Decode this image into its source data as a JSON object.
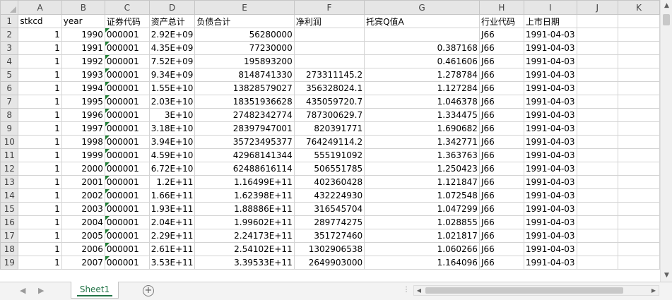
{
  "columns": [
    "A",
    "B",
    "C",
    "D",
    "E",
    "F",
    "G",
    "H",
    "I",
    "J",
    "K"
  ],
  "header_row": {
    "number": "1",
    "cells": [
      "stkcd",
      "year",
      "证券代码",
      "资产总计",
      "负债合计",
      "净利润",
      "托宾Q值A",
      "行业代码",
      "上市日期",
      "",
      ""
    ]
  },
  "rows": [
    {
      "number": "2",
      "stkcd": "1",
      "year": "1990",
      "code": "000001",
      "assets": "2.92E+09",
      "liabilities": "56280000",
      "net_profit": "",
      "tobin_q": "",
      "industry": "J66",
      "listed": "1991-04-03"
    },
    {
      "number": "3",
      "stkcd": "1",
      "year": "1991",
      "code": "000001",
      "assets": "4.35E+09",
      "liabilities": "77230000",
      "net_profit": "",
      "tobin_q": "0.387168",
      "industry": "J66",
      "listed": "1991-04-03"
    },
    {
      "number": "4",
      "stkcd": "1",
      "year": "1992",
      "code": "000001",
      "assets": "7.52E+09",
      "liabilities": "195893200",
      "net_profit": "",
      "tobin_q": "0.461606",
      "industry": "J66",
      "listed": "1991-04-03"
    },
    {
      "number": "5",
      "stkcd": "1",
      "year": "1993",
      "code": "000001",
      "assets": "9.34E+09",
      "liabilities": "8148741330",
      "net_profit": "273311145.2",
      "tobin_q": "1.278784",
      "industry": "J66",
      "listed": "1991-04-03"
    },
    {
      "number": "6",
      "stkcd": "1",
      "year": "1994",
      "code": "000001",
      "assets": "1.55E+10",
      "liabilities": "13828579027",
      "net_profit": "356328024.1",
      "tobin_q": "1.127284",
      "industry": "J66",
      "listed": "1991-04-03"
    },
    {
      "number": "7",
      "stkcd": "1",
      "year": "1995",
      "code": "000001",
      "assets": "2.03E+10",
      "liabilities": "18351936628",
      "net_profit": "435059720.7",
      "tobin_q": "1.046378",
      "industry": "J66",
      "listed": "1991-04-03"
    },
    {
      "number": "8",
      "stkcd": "1",
      "year": "1996",
      "code": "000001",
      "assets": "3E+10",
      "liabilities": "27482342774",
      "net_profit": "787300629.7",
      "tobin_q": "1.334475",
      "industry": "J66",
      "listed": "1991-04-03"
    },
    {
      "number": "9",
      "stkcd": "1",
      "year": "1997",
      "code": "000001",
      "assets": "3.18E+10",
      "liabilities": "28397947001",
      "net_profit": "820391771",
      "tobin_q": "1.690682",
      "industry": "J66",
      "listed": "1991-04-03"
    },
    {
      "number": "10",
      "stkcd": "1",
      "year": "1998",
      "code": "000001",
      "assets": "3.94E+10",
      "liabilities": "35723495377",
      "net_profit": "764249114.2",
      "tobin_q": "1.342771",
      "industry": "J66",
      "listed": "1991-04-03"
    },
    {
      "number": "11",
      "stkcd": "1",
      "year": "1999",
      "code": "000001",
      "assets": "4.59E+10",
      "liabilities": "42968141344",
      "net_profit": "555191092",
      "tobin_q": "1.363763",
      "industry": "J66",
      "listed": "1991-04-03"
    },
    {
      "number": "12",
      "stkcd": "1",
      "year": "2000",
      "code": "000001",
      "assets": "6.72E+10",
      "liabilities": "62488616114",
      "net_profit": "506551785",
      "tobin_q": "1.250423",
      "industry": "J66",
      "listed": "1991-04-03"
    },
    {
      "number": "13",
      "stkcd": "1",
      "year": "2001",
      "code": "000001",
      "assets": "1.2E+11",
      "liabilities": "1.16499E+11",
      "net_profit": "402360428",
      "tobin_q": "1.121847",
      "industry": "J66",
      "listed": "1991-04-03"
    },
    {
      "number": "14",
      "stkcd": "1",
      "year": "2002",
      "code": "000001",
      "assets": "1.66E+11",
      "liabilities": "1.62398E+11",
      "net_profit": "432224930",
      "tobin_q": "1.072548",
      "industry": "J66",
      "listed": "1991-04-03"
    },
    {
      "number": "15",
      "stkcd": "1",
      "year": "2003",
      "code": "000001",
      "assets": "1.93E+11",
      "liabilities": "1.88886E+11",
      "net_profit": "316545704",
      "tobin_q": "1.047299",
      "industry": "J66",
      "listed": "1991-04-03"
    },
    {
      "number": "16",
      "stkcd": "1",
      "year": "2004",
      "code": "000001",
      "assets": "2.04E+11",
      "liabilities": "1.99602E+11",
      "net_profit": "289774275",
      "tobin_q": "1.028855",
      "industry": "J66",
      "listed": "1991-04-03"
    },
    {
      "number": "17",
      "stkcd": "1",
      "year": "2005",
      "code": "000001",
      "assets": "2.29E+11",
      "liabilities": "2.24173E+11",
      "net_profit": "351727460",
      "tobin_q": "1.021817",
      "industry": "J66",
      "listed": "1991-04-03"
    },
    {
      "number": "18",
      "stkcd": "1",
      "year": "2006",
      "code": "000001",
      "assets": "2.61E+11",
      "liabilities": "2.54102E+11",
      "net_profit": "1302906538",
      "tobin_q": "1.060266",
      "industry": "J66",
      "listed": "1991-04-03"
    },
    {
      "number": "19",
      "stkcd": "1",
      "year": "2007",
      "code": "000001",
      "assets": "3.53E+11",
      "liabilities": "3.39533E+11",
      "net_profit": "2649903000",
      "tobin_q": "1.164096",
      "industry": "J66",
      "listed": "1991-04-03"
    }
  ],
  "tabs": {
    "sheet_name": "Sheet1",
    "add_sheet": "+",
    "prev_sheet_icon": "◀",
    "next_sheet_icon": "▶",
    "more_dots": "⋮"
  },
  "icons": {
    "select_all": "select-all-triangle-icon",
    "error_indicator": "green-triangle-icon",
    "up_arrow": "▲",
    "down_arrow": "▼",
    "left_arrow": "◀",
    "right_arrow": "▶"
  },
  "colors": {
    "accent": "#217346",
    "error_indicator": "#1e7e34",
    "header_bg": "#e6e6e6"
  }
}
